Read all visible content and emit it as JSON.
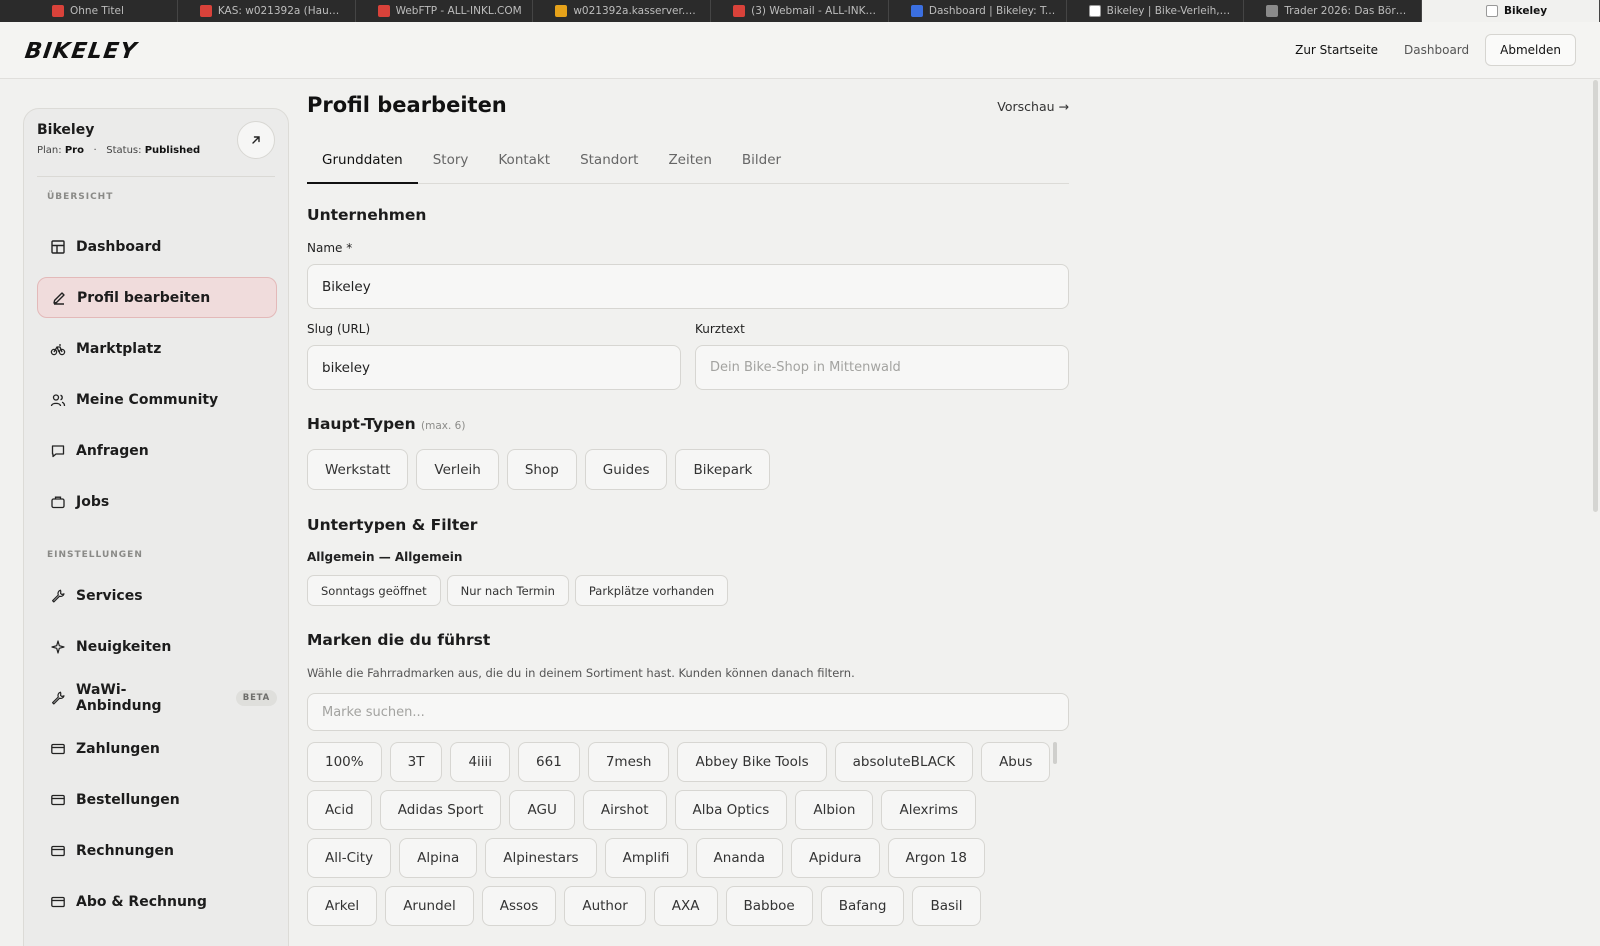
{
  "browser_tabs": [
    {
      "title": "Ohne Titel",
      "color": "#d9423a"
    },
    {
      "title": "KAS: w021392a (Haupta...",
      "color": "#d9423a"
    },
    {
      "title": "WebFTP - ALL-INKL.COM",
      "color": "#d9423a"
    },
    {
      "title": "w021392a.kasserver.co...",
      "color": "#e6a21a"
    },
    {
      "title": "(3) Webmail - ALL-INKL....",
      "color": "#d9423a"
    },
    {
      "title": "Dashboard | Bikeley: To...",
      "color": "#3b6fe0"
    },
    {
      "title": "Bikeley | Bike-Verleih, W...",
      "color": "#ffffff"
    },
    {
      "title": "Trader 2026: Das Börse...",
      "color": "#8a8a8a"
    },
    {
      "title": "Bikeley",
      "color": "#ffffff",
      "active": true
    }
  ],
  "header": {
    "logo": "BIKELEY",
    "nav": {
      "start": "Zur Startseite",
      "dashboard": "Dashboard",
      "logout": "Abmelden"
    }
  },
  "sidebar": {
    "shop_name": "Bikeley",
    "plan_label": "Plan:",
    "plan_value": "Pro",
    "separator": "·",
    "status_label": "Status:",
    "status_value": "Published",
    "section_overview": "ÜBERSICHT",
    "section_settings": "EINSTELLUNGEN",
    "items": [
      {
        "label": "Dashboard",
        "icon": "grid-icon"
      },
      {
        "label": "Profil bearbeiten",
        "icon": "pencil-icon",
        "active": true
      },
      {
        "label": "Marktplatz",
        "icon": "bike-icon"
      },
      {
        "label": "Meine Community",
        "icon": "users-icon"
      },
      {
        "label": "Anfragen",
        "icon": "message-icon"
      },
      {
        "label": "Jobs",
        "icon": "briefcase-icon"
      },
      {
        "label": "Services",
        "icon": "wrench-icon"
      },
      {
        "label": "Neuigkeiten",
        "icon": "sparkle-icon"
      },
      {
        "label": "WaWi-Anbindung",
        "icon": "wrench-icon",
        "badge": "BETA"
      },
      {
        "label": "Zahlungen",
        "icon": "card-icon"
      },
      {
        "label": "Bestellungen",
        "icon": "card-icon"
      },
      {
        "label": "Rechnungen",
        "icon": "card-icon"
      },
      {
        "label": "Abo & Rechnung",
        "icon": "card-icon"
      }
    ]
  },
  "main": {
    "title": "Profil bearbeiten",
    "preview": "Vorschau →",
    "tabs": [
      "Grunddaten",
      "Story",
      "Kontakt",
      "Standort",
      "Zeiten",
      "Bilder"
    ],
    "active_tab": "Grunddaten",
    "company": {
      "heading": "Unternehmen",
      "name_label": "Name *",
      "name_value": "Bikeley",
      "slug_label": "Slug (URL)",
      "slug_value": "bikeley",
      "short_label": "Kurztext",
      "short_placeholder": "Dein Bike-Shop in Mittenwald"
    },
    "main_types": {
      "heading": "Haupt-Typen",
      "hint": "(max. 6)",
      "options": [
        "Werkstatt",
        "Verleih",
        "Shop",
        "Guides",
        "Bikepark"
      ]
    },
    "subtypes": {
      "heading": "Untertypen & Filter",
      "group_label": "Allgemein — Allgemein",
      "options": [
        "Sonntags geöffnet",
        "Nur nach Termin",
        "Parkplätze vorhanden"
      ]
    },
    "brands": {
      "heading": "Marken die du führst",
      "description": "Wähle die Fahrradmarken aus, die du in deinem Sortiment hast. Kunden können danach filtern.",
      "search_placeholder": "Marke suchen...",
      "rows": [
        [
          "100%",
          "3T",
          "4iiii",
          "661",
          "7mesh",
          "Abbey Bike Tools",
          "absoluteBLACK",
          "Abus"
        ],
        [
          "Acid",
          "Adidas Sport",
          "AGU",
          "Airshot",
          "Alba Optics",
          "Albion",
          "Alexrims"
        ],
        [
          "All-City",
          "Alpina",
          "Alpinestars",
          "Amplifi",
          "Ananda",
          "Apidura",
          "Argon 18"
        ],
        [
          "Arkel",
          "Arundel",
          "Assos",
          "Author",
          "AXA",
          "Babboe",
          "Bafang",
          "Basil"
        ]
      ]
    }
  }
}
